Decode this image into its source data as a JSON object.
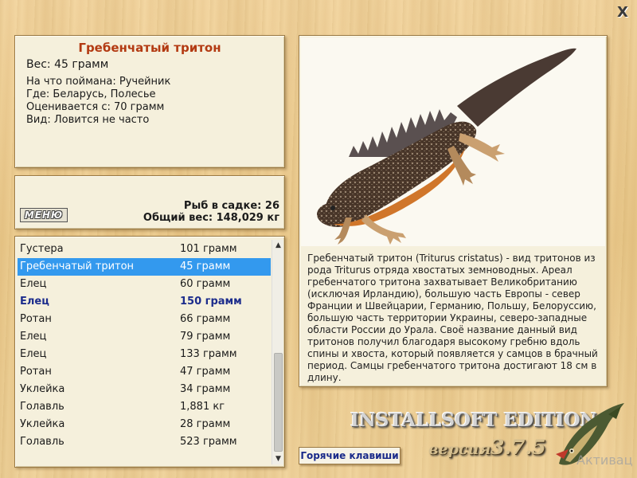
{
  "close_label": "X",
  "info": {
    "title": "Гребенчатый тритон",
    "weight": "Вес: 45 грамм",
    "caught_with": "На что поймана: Ручейник",
    "location": "Где: Беларусь, Полесье",
    "rated_from": "Оценивается с: 70 грамм",
    "frequency": "Вид: Ловится не часто"
  },
  "stats": {
    "menu_label": "МЕНЮ",
    "fish_count": "Рыб в садке: 26",
    "total_weight": "Общий вес: 148,029 кг"
  },
  "catch_list": [
    {
      "name": "Густера",
      "weight": "101 грамм"
    },
    {
      "name": "Гребенчатый тритон",
      "weight": "45 грамм",
      "selected": true
    },
    {
      "name": "Елец",
      "weight": "60 грамм"
    },
    {
      "name": "Елец",
      "weight": "150 грамм",
      "highlight": true
    },
    {
      "name": "Ротан",
      "weight": "66 грамм"
    },
    {
      "name": "Елец",
      "weight": "79 грамм"
    },
    {
      "name": "Елец",
      "weight": "133 грамм"
    },
    {
      "name": "Ротан",
      "weight": "47 грамм"
    },
    {
      "name": "Уклейка",
      "weight": "34 грамм"
    },
    {
      "name": "Голавль",
      "weight": "1,881 кг"
    },
    {
      "name": "Уклейка",
      "weight": "28 грамм"
    },
    {
      "name": "Голавль",
      "weight": "523 грамм"
    }
  ],
  "description": "Гребенчатый тритон (Triturus cristatus) - вид тритонов из рода Triturus отряда хвостатых земноводных. Ареал гребенчатого тритона захватывает Великобританию (исключая Ирландию), большую часть Европы - север Франции и Швейцарии, Германию, Польшу, Белоруссию, большую часть территории Украины, северо-западные области России до Урала. Своё название данный вид тритонов получил благодаря высокому гребню вдоль спины и хвоста, который появляется у самцов в брачный период. Самцы гребенчатого тритона достигают 18 см в длину.",
  "hotkeys_label": "Горячие клавиши",
  "brand": {
    "edition": "INSTALLSOFT EDITION",
    "version_word": "версия",
    "version_number": "3.7.5"
  },
  "activation_text": "Активац",
  "colors": {
    "title_red": "#b33a12",
    "selection_blue": "#3399ee",
    "highlight_navy": "#1c2c8c"
  }
}
